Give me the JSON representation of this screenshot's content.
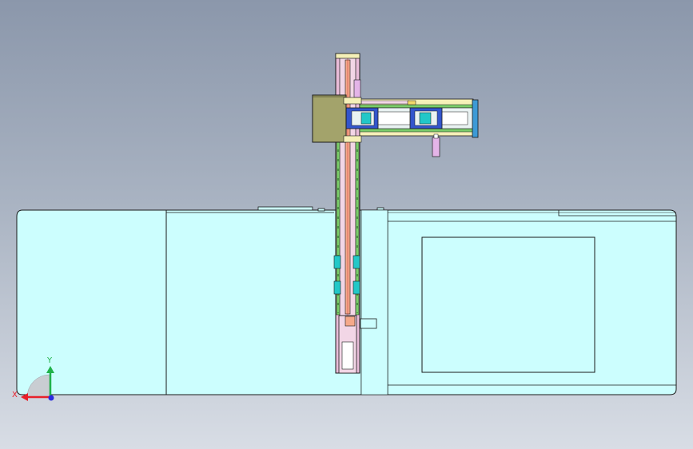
{
  "view": {
    "background_top": "#8b97ab",
    "background_bottom": "#d8dde5",
    "body_fill": "#ccfefe",
    "edge_color": "#1a1a1a"
  },
  "triad": {
    "x_label": "X",
    "y_label": "Y",
    "x_color": "#e8202a",
    "y_color": "#21b24a",
    "z_color": "#2a2ae0"
  },
  "parts": {
    "carriage_color": "#a3a36b",
    "rail_color": "#e8bcd8",
    "beam_color": "#f5f0b8",
    "motor_color": "#3355cc",
    "end_cap_color": "#3d9ad6",
    "bearing_color": "#22c8c8",
    "cylinder_color": "#e4b4e8"
  }
}
